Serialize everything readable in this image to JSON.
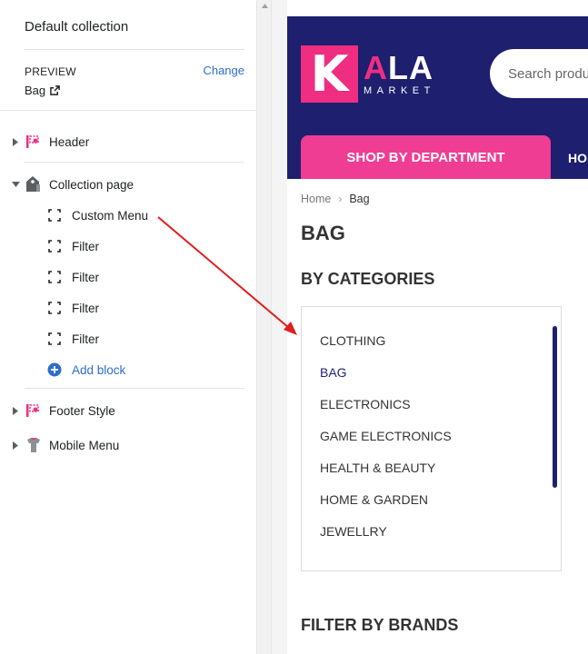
{
  "sidebar": {
    "title": "Default collection",
    "preview": {
      "label": "PREVIEW",
      "change": "Change",
      "value": "Bag",
      "value_icon": "external-link-icon"
    },
    "sections": {
      "header": {
        "label": "Header",
        "icon": "header-icon"
      },
      "collection": {
        "label": "Collection page",
        "icon": "tag-icon"
      },
      "footer": {
        "label": "Footer Style",
        "icon": "footer-icon"
      },
      "mobile": {
        "label": "Mobile Menu",
        "icon": "mobile-menu-icon"
      }
    },
    "blocks": [
      {
        "label": "Custom Menu",
        "icon": "dashed-square-icon"
      },
      {
        "label": "Filter",
        "icon": "dashed-square-icon"
      },
      {
        "label": "Filter",
        "icon": "dashed-square-icon"
      },
      {
        "label": "Filter",
        "icon": "dashed-square-icon"
      },
      {
        "label": "Filter",
        "icon": "dashed-square-icon"
      }
    ],
    "add_block": {
      "label": "Add block",
      "icon": "plus-circle-icon"
    }
  },
  "store": {
    "logo": {
      "letter": "K",
      "word_pink": "A",
      "word_rest": "LA",
      "sub": "MARKET"
    },
    "search_placeholder": "Search produ",
    "shop_button": "SHOP BY DEPARTMENT",
    "nav_fragment": "HO",
    "breadcrumb": {
      "home": "Home",
      "current": "Bag"
    },
    "page_title": "BAG",
    "categories_heading": "BY CATEGORIES",
    "categories": [
      "CLOTHING",
      "BAG",
      "ELECTRONICS",
      "GAME ELECTRONICS",
      "HEALTH & BEAUTY",
      "HOME & GARDEN",
      "JEWELLRY"
    ],
    "active_category": "BAG",
    "brands_heading": "FILTER BY BRANDS"
  },
  "colors": {
    "header_bg": "#1e1f6e",
    "accent_pink": "#ef3d93",
    "link_blue": "#2c6ecb",
    "annotation_red": "#e11d1d"
  }
}
